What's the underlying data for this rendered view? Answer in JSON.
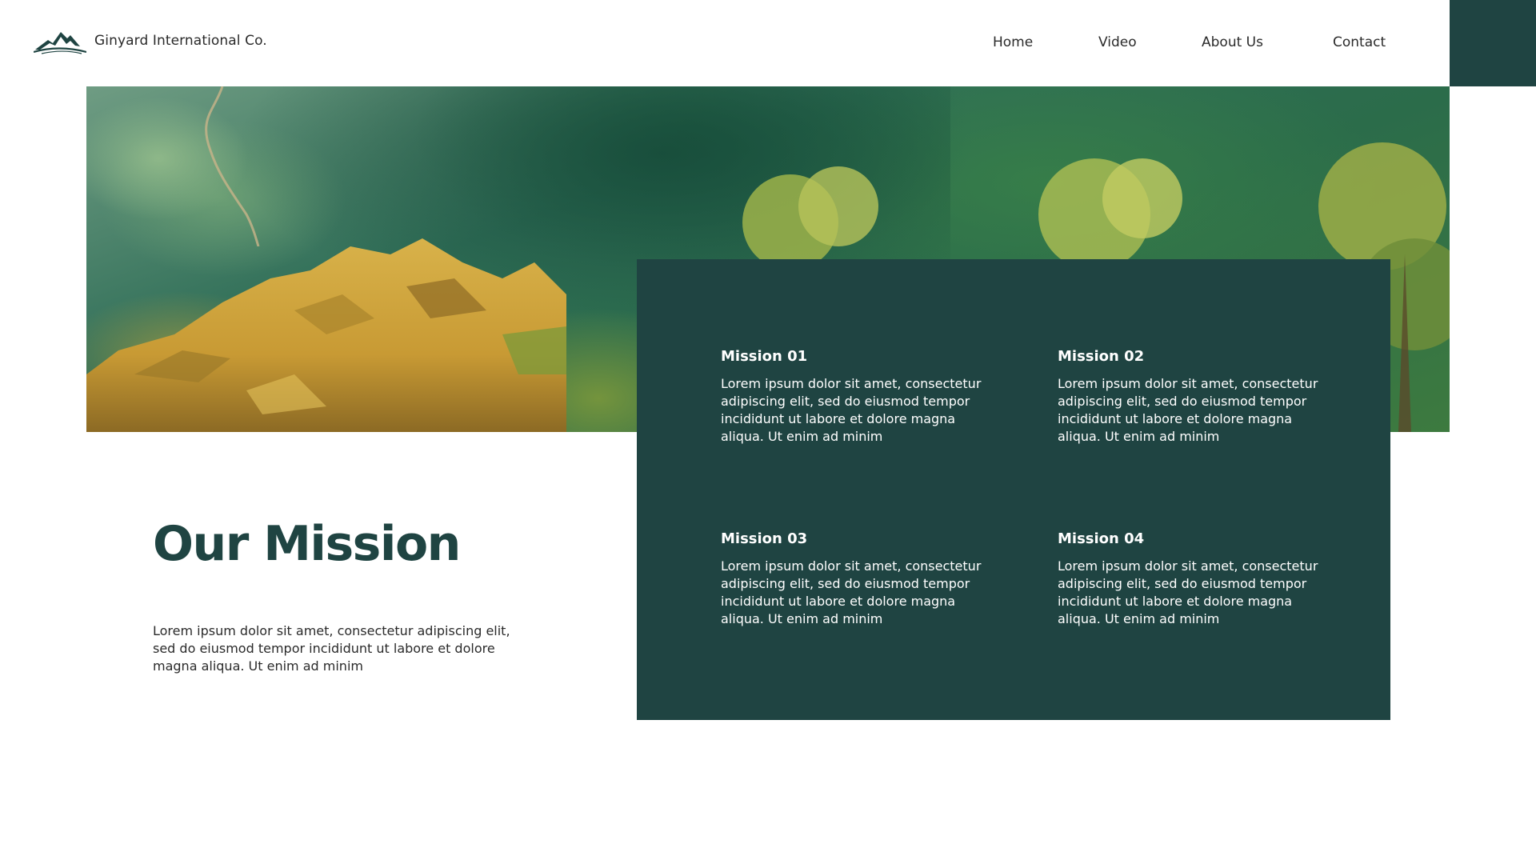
{
  "brand": {
    "company_name": "Ginyard International Co.",
    "logo_icon": "mountain-logo-icon",
    "accent_color": "#1f4442"
  },
  "nav": {
    "items": [
      "Home",
      "Video",
      "About Us",
      "Contact"
    ]
  },
  "main": {
    "title": "Our Mission",
    "intro": "Lorem ipsum dolor sit amet, consectetur adipiscing elit, sed do eiusmod tempor incididunt ut labore et dolore magna aliqua. Ut enim ad minim"
  },
  "missions": [
    {
      "title": "Mission 01",
      "text": "Lorem ipsum dolor sit amet, consectetur adipiscing elit, sed do eiusmod tempor incididunt ut labore et dolore magna aliqua. Ut enim ad minim"
    },
    {
      "title": "Mission 02",
      "text": "Lorem ipsum dolor sit amet, consectetur adipiscing elit, sed do eiusmod tempor incididunt ut labore et dolore magna aliqua. Ut enim ad minim"
    },
    {
      "title": "Mission 03",
      "text": "Lorem ipsum dolor sit amet, consectetur adipiscing elit, sed do eiusmod tempor incididunt ut labore et dolore magna aliqua. Ut enim ad minim"
    },
    {
      "title": "Mission 04",
      "text": "Lorem ipsum dolor sit amet, consectetur adipiscing elit, sed do eiusmod tempor incididunt ut labore et dolore magna aliqua. Ut enim ad minim"
    }
  ]
}
